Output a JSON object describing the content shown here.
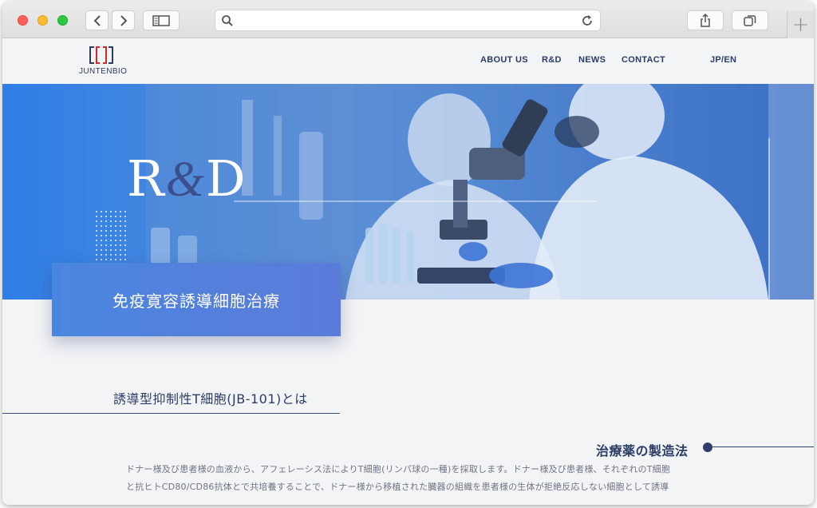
{
  "nav": {
    "about": "ABOUT US",
    "rd": "R&D",
    "news": "NEWS",
    "contact": "CONTACT",
    "lang": "JP/EN"
  },
  "logo": {
    "text": "JUNTENBIO"
  },
  "hero": {
    "title_r": "R",
    "title_amp": "&",
    "title_d": "D",
    "box_label": "免疫寛容誘導細胞治療"
  },
  "content": {
    "section_heading": "誘導型抑制性T細胞(JB-101)とは",
    "sub_heading": "治療薬の製造法",
    "paragraph_line1": "ドナー様及び患者様の血液から、アフェレーシス法によりT細胞(リンパ球の一種)を採取します。ドナー様及び患者様、それぞれのT細胞",
    "paragraph_line2": "と抗ヒトCD80/CD86抗体とで共培養することで、ドナー様から移植された臓器の組織を患者様の生体が拒絶反応しない細胞として誘導"
  },
  "colors": {
    "navy": "#2b3d66",
    "hero_blue": "#3b7ddb",
    "box_blue": "#4a86df",
    "logo_red": "#d8262c"
  },
  "icons": {
    "back": "chevron-left-icon",
    "forward": "chevron-right-icon",
    "sidebar": "sidebar-icon",
    "search": "search-icon",
    "reload": "reload-icon",
    "share": "share-icon",
    "tabs": "tabs-icon",
    "new_tab": "plus-icon"
  }
}
